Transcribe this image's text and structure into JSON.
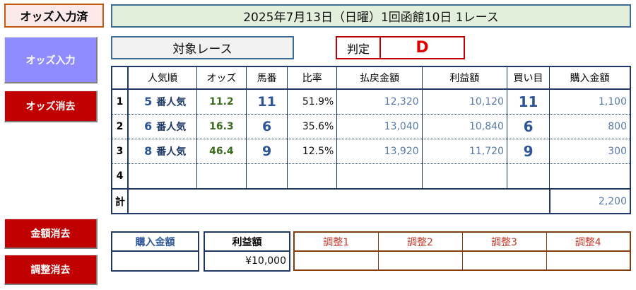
{
  "status": "オッズ入力済",
  "race_title": "2025年7月13日（日曜）1回函館10日 1レース",
  "buttons": {
    "odds_input": "オッズ入力",
    "odds_clear": "オッズ消去",
    "amount_clear": "金額消去",
    "adjust_clear": "調整消去"
  },
  "target_race": "対象レース",
  "verdict": {
    "label": "判定",
    "value": "D"
  },
  "table": {
    "headers": [
      "人気順",
      "オッズ",
      "馬番",
      "比率",
      "払戻金額",
      "利益額",
      "買い目",
      "購入金額"
    ],
    "popularity_suffix": "番人気",
    "rows": [
      {
        "index": "1",
        "popularity": "5",
        "odds": "11.2",
        "horse": "11",
        "ratio": "51.9%",
        "payout": "12,320",
        "profit": "10,120",
        "kaime": "11",
        "purchase": "1,100"
      },
      {
        "index": "2",
        "popularity": "6",
        "odds": "16.3",
        "horse": "6",
        "ratio": "35.6%",
        "payout": "13,040",
        "profit": "10,840",
        "kaime": "6",
        "purchase": "800"
      },
      {
        "index": "3",
        "popularity": "8",
        "odds": "46.4",
        "horse": "9",
        "ratio": "12.5%",
        "payout": "13,920",
        "profit": "11,720",
        "kaime": "9",
        "purchase": "300"
      },
      {
        "index": "4",
        "popularity": "",
        "odds": "",
        "horse": "",
        "ratio": "",
        "payout": "",
        "profit": "",
        "kaime": "",
        "purchase": ""
      }
    ],
    "total_label": "計",
    "total_purchase": "2,200"
  },
  "summary": {
    "purchase_label": "購入金額",
    "purchase_value": "",
    "profit_label": "利益額",
    "profit_value": "¥10,000"
  },
  "adjust": {
    "labels": [
      "調整1",
      "調整2",
      "調整3",
      "調整4"
    ],
    "values": [
      "",
      "",
      "",
      ""
    ]
  }
}
